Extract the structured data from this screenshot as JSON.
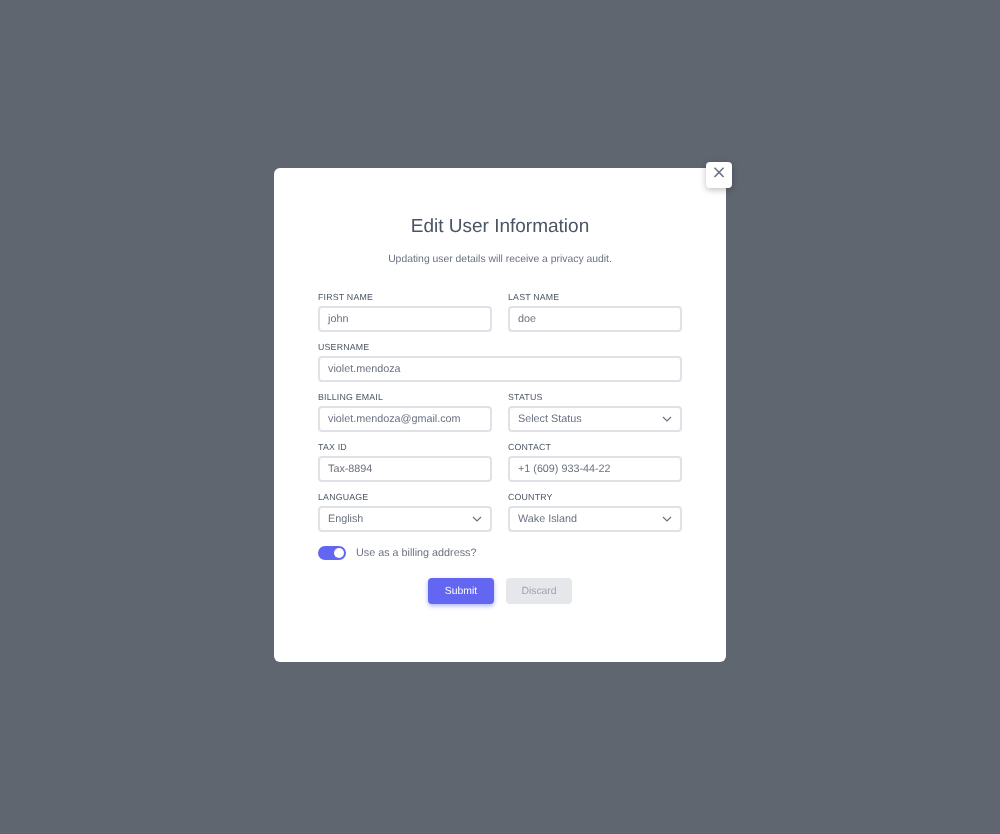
{
  "dialog": {
    "title": "Edit User Information",
    "subtitle": "Updating user details will receive a privacy audit.",
    "close": "×"
  },
  "fields": [
    {
      "label": "FIRST NAME",
      "value": "john",
      "kind": "text",
      "full": false
    },
    {
      "label": "LAST NAME",
      "value": "doe",
      "kind": "text",
      "full": false
    },
    {
      "label": "USERNAME",
      "value": "violet.mendoza",
      "kind": "text",
      "full": true
    },
    {
      "label": "BILLING EMAIL",
      "value": "violet.mendoza@gmail.com",
      "kind": "text",
      "full": false
    },
    {
      "label": "STATUS",
      "value": "Select Status",
      "kind": "select",
      "full": false
    },
    {
      "label": "TAX ID",
      "value": "Tax-8894",
      "kind": "text",
      "full": false
    },
    {
      "label": "CONTACT",
      "value": "+1 (609) 933-44-22",
      "kind": "text",
      "full": false
    },
    {
      "label": "LANGUAGE",
      "value": "English",
      "kind": "select",
      "full": false
    },
    {
      "label": "COUNTRY",
      "value": "Wake Island",
      "kind": "select",
      "full": false
    }
  ],
  "billing_toggle": {
    "label": "Use as a billing address?",
    "on": true
  },
  "buttons": [
    {
      "label": "Submit",
      "kind": "primary"
    },
    {
      "label": "Discard",
      "kind": "secondary"
    }
  ]
}
